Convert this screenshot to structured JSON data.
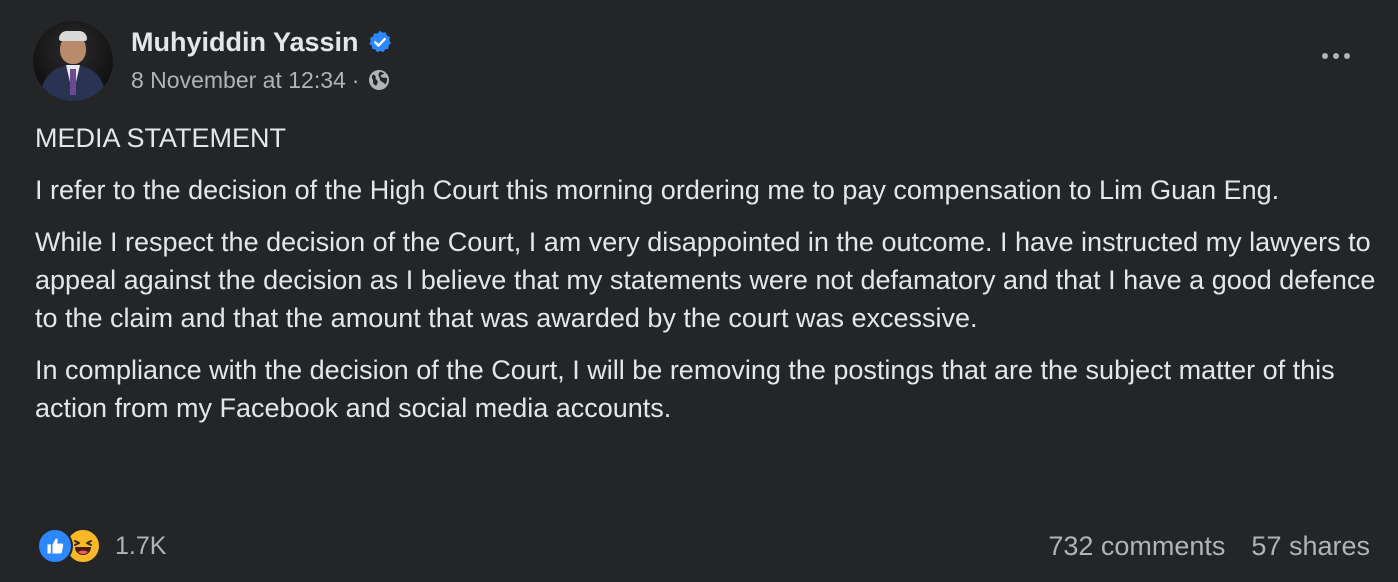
{
  "author": {
    "name": "Muhyiddin Yassin",
    "verified": true,
    "timestamp": "8 November at 12:34",
    "separator": "·",
    "audience_icon": "globe-icon"
  },
  "post": {
    "paragraphs": [
      "MEDIA STATEMENT",
      "I refer to the decision of the High Court this morning ordering me to pay compensation to Lim Guan Eng.",
      "While I respect the decision of the Court, I am very disappointed in the outcome. I have instructed my lawyers to appeal against the decision as I believe that my statements were not defamatory and that I have a good defence to the claim and that the amount that was awarded by the court was excessive.",
      "In compliance with the decision of the Court, I will be removing the postings that are the subject matter of this action from my Facebook and social media accounts."
    ]
  },
  "footer": {
    "reaction_icons": [
      "like-icon",
      "haha-icon"
    ],
    "reaction_count": "1.7K",
    "comments": "732 comments",
    "shares": "57 shares"
  },
  "colors": {
    "background": "#242526",
    "text_primary": "#e4e6eb",
    "text_secondary": "#b0b3b8",
    "verified": "#2d88ff",
    "like": "#2d88ff",
    "haha": "#f7b928"
  }
}
